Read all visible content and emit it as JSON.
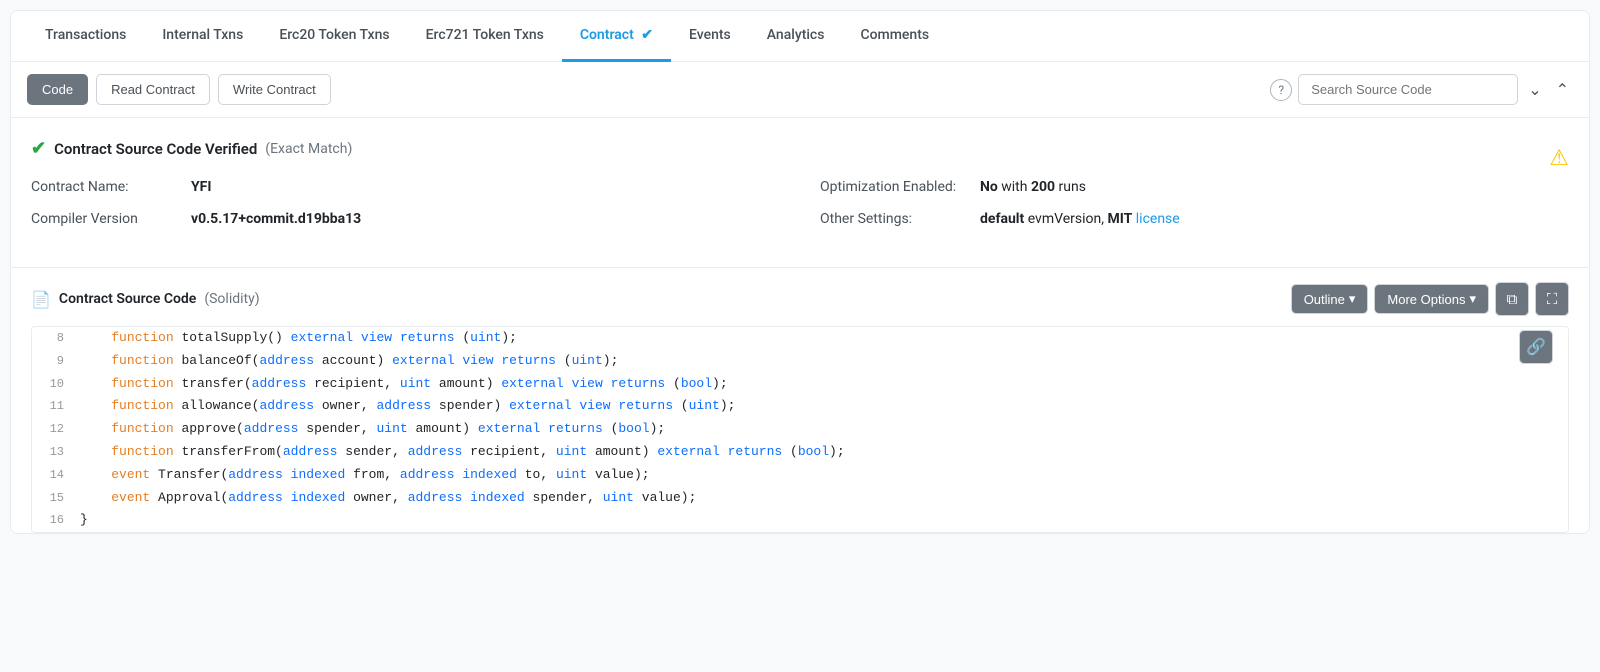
{
  "tabs": [
    {
      "id": "transactions",
      "label": "Transactions",
      "active": false
    },
    {
      "id": "internal-txns",
      "label": "Internal Txns",
      "active": false
    },
    {
      "id": "erc20",
      "label": "Erc20 Token Txns",
      "active": false
    },
    {
      "id": "erc721",
      "label": "Erc721 Token Txns",
      "active": false
    },
    {
      "id": "contract",
      "label": "Contract",
      "active": true,
      "verified": true
    },
    {
      "id": "events",
      "label": "Events",
      "active": false
    },
    {
      "id": "analytics",
      "label": "Analytics",
      "active": false
    },
    {
      "id": "comments",
      "label": "Comments",
      "active": false
    }
  ],
  "subtabs": [
    {
      "id": "code",
      "label": "Code",
      "active": true
    },
    {
      "id": "read-contract",
      "label": "Read Contract",
      "active": false
    },
    {
      "id": "write-contract",
      "label": "Write Contract",
      "active": false
    }
  ],
  "search": {
    "placeholder": "Search Source Code"
  },
  "contract": {
    "verified_text": "Contract Source Code Verified",
    "exact_match": "(Exact Match)",
    "fields": {
      "name_label": "Contract Name:",
      "name_value": "YFI",
      "compiler_label": "Compiler Version",
      "compiler_value": "v0.5.17+commit.d19bba13",
      "optimization_label": "Optimization Enabled:",
      "optimization_value_no": "No",
      "optimization_value_rest": " with ",
      "optimization_runs": "200",
      "optimization_suffix": " runs",
      "other_label": "Other Settings:",
      "other_default": "default",
      "other_evm": " evmVersion, ",
      "other_mit": "MIT",
      "other_license_text": " license"
    }
  },
  "source": {
    "title": "Contract Source Code",
    "solidity_label": "(Solidity)",
    "toolbar": {
      "outline_label": "Outline",
      "more_options_label": "More Options"
    },
    "code_lines": [
      {
        "num": "8",
        "code": "    function totalSupply() external view returns (uint);"
      },
      {
        "num": "9",
        "code": "    function balanceOf(address account) external view returns (uint);"
      },
      {
        "num": "10",
        "code": "    function transfer(address recipient, uint amount) external view returns (bool);"
      },
      {
        "num": "11",
        "code": "    function allowance(address owner, address spender) external view returns (uint);"
      },
      {
        "num": "12",
        "code": "    function approve(address spender, uint amount) external returns (bool);"
      },
      {
        "num": "13",
        "code": "    function transferFrom(address sender, address recipient, uint amount) external returns (bool);"
      },
      {
        "num": "14",
        "code": "    event Transfer(address indexed from, address indexed to, uint value);"
      },
      {
        "num": "15",
        "code": "    event Approval(address indexed owner, address indexed spender, uint value);"
      },
      {
        "num": "16",
        "code": "}"
      }
    ]
  },
  "icons": {
    "check": "✔",
    "warning": "⚠",
    "question": "?",
    "chevron_down": "∨",
    "chevron_up": "∧",
    "file": "🗎",
    "copy": "⧉",
    "expand": "⛶",
    "link": "🔗"
  }
}
